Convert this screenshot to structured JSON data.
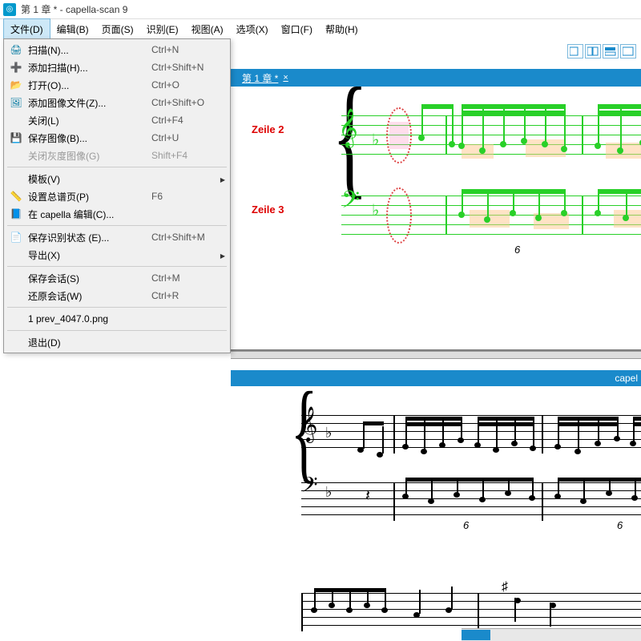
{
  "title": "第 1 章 * - capella-scan 9",
  "menubar": [
    "文件(D)",
    "编辑(B)",
    "页面(S)",
    "识别(E)",
    "视图(A)",
    "选项(X)",
    "窗口(F)",
    "帮助(H)"
  ],
  "file_menu": {
    "groups": [
      [
        {
          "icon": "scan",
          "label": "扫描(N)...",
          "shortcut": "Ctrl+N"
        },
        {
          "icon": "addscan",
          "label": "添加扫描(H)...",
          "shortcut": "Ctrl+Shift+N"
        },
        {
          "icon": "open",
          "label": "打开(O)...",
          "shortcut": "Ctrl+O"
        },
        {
          "icon": "addimg",
          "label": "添加图像文件(Z)...",
          "shortcut": "Ctrl+Shift+O"
        },
        {
          "icon": "",
          "label": "关闭(L)",
          "shortcut": "Ctrl+F4"
        },
        {
          "icon": "save",
          "label": "保存图像(B)...",
          "shortcut": "Ctrl+U"
        },
        {
          "icon": "",
          "label": "关闭灰度图像(G)",
          "shortcut": "Shift+F4",
          "disabled": true
        }
      ],
      [
        {
          "icon": "",
          "label": "模板(V)",
          "shortcut": "",
          "submenu": true
        },
        {
          "icon": "ruler",
          "label": "设置总谱页(P)",
          "shortcut": "F6"
        },
        {
          "icon": "cap",
          "label": "在 capella 编辑(C)...",
          "shortcut": ""
        }
      ],
      [
        {
          "icon": "state",
          "label": "保存识别状态  (E)...",
          "shortcut": "Ctrl+Shift+M"
        },
        {
          "icon": "",
          "label": "导出(X)",
          "shortcut": "",
          "submenu": true
        }
      ],
      [
        {
          "icon": "",
          "label": "保存会话(S)",
          "shortcut": "Ctrl+M"
        },
        {
          "icon": "",
          "label": "还原会话(W)",
          "shortcut": "Ctrl+R"
        }
      ],
      [
        {
          "icon": "",
          "label": "1 prev_4047.0.png",
          "shortcut": ""
        }
      ],
      [
        {
          "icon": "",
          "label": "退出(D)",
          "shortcut": ""
        }
      ]
    ]
  },
  "tab": {
    "label": "第 1 章 *",
    "close": "×"
  },
  "staff_labels": {
    "zeile2": "Zeile 2",
    "zeile3": "Zeile 3"
  },
  "preview_title": "capel",
  "tuplet6": "6"
}
